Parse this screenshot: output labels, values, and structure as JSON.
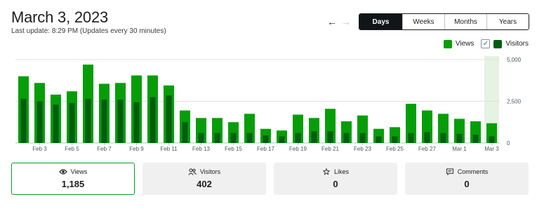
{
  "header": {
    "date": "March 3, 2023",
    "last_update": "Last update: 8:29 PM (Updates every 30 minutes)"
  },
  "nav": {
    "prev_icon": "←",
    "next_icon": "→"
  },
  "period_tabs": [
    {
      "label": "Days",
      "active": true
    },
    {
      "label": "Weeks",
      "active": false
    },
    {
      "label": "Months",
      "active": false
    },
    {
      "label": "Years",
      "active": false
    }
  ],
  "legend": {
    "views_label": "Views",
    "visitors_label": "Visitors",
    "visitors_checked": true,
    "views_color": "#069e08",
    "visitors_color": "#005d10"
  },
  "chart_data": {
    "type": "bar",
    "categories": [
      "Feb 2",
      "Feb 3",
      "Feb 4",
      "Feb 5",
      "Feb 6",
      "Feb 7",
      "Feb 8",
      "Feb 9",
      "Feb 10",
      "Feb 11",
      "Feb 12",
      "Feb 13",
      "Feb 14",
      "Feb 15",
      "Feb 16",
      "Feb 17",
      "Feb 18",
      "Feb 19",
      "Feb 20",
      "Feb 21",
      "Feb 22",
      "Feb 23",
      "Feb 24",
      "Feb 25",
      "Feb 26",
      "Feb 27",
      "Feb 28",
      "Mar 1",
      "Mar 2",
      "Mar 3"
    ],
    "tick_labels": [
      "Feb 3",
      "Feb 5",
      "Feb 7",
      "Feb 9",
      "Feb 11",
      "Feb 13",
      "Feb 15",
      "Feb 17",
      "Feb 19",
      "Feb 21",
      "Feb 23",
      "Feb 25",
      "Feb 27",
      "Mar 1",
      "Mar 3"
    ],
    "series": [
      {
        "name": "Views",
        "values": [
          4000,
          3600,
          2900,
          3100,
          4700,
          3550,
          3600,
          4050,
          4050,
          3450,
          1950,
          1500,
          1500,
          1250,
          1750,
          850,
          750,
          1700,
          1500,
          2050,
          1300,
          1650,
          850,
          950,
          2350,
          1950,
          1750,
          1450,
          1300,
          1185
        ]
      },
      {
        "name": "Visitors",
        "values": [
          2650,
          2500,
          2300,
          2400,
          2650,
          2600,
          2600,
          2450,
          2750,
          2850,
          1250,
          600,
          600,
          600,
          600,
          450,
          400,
          600,
          700,
          700,
          600,
          600,
          400,
          400,
          600,
          650,
          600,
          550,
          500,
          402
        ]
      }
    ],
    "ylim": [
      0,
      5000
    ],
    "yticks": [
      "0",
      "2,500",
      "5,000"
    ],
    "highlighted_category": "Mar 3"
  },
  "cards": [
    {
      "label": "Views",
      "value": "1,185",
      "icon": "eye-icon",
      "active": true
    },
    {
      "label": "Visitors",
      "value": "402",
      "icon": "people-icon",
      "active": false
    },
    {
      "label": "Likes",
      "value": "0",
      "icon": "star-icon",
      "active": false
    },
    {
      "label": "Comments",
      "value": "0",
      "icon": "comment-icon",
      "active": false
    }
  ]
}
